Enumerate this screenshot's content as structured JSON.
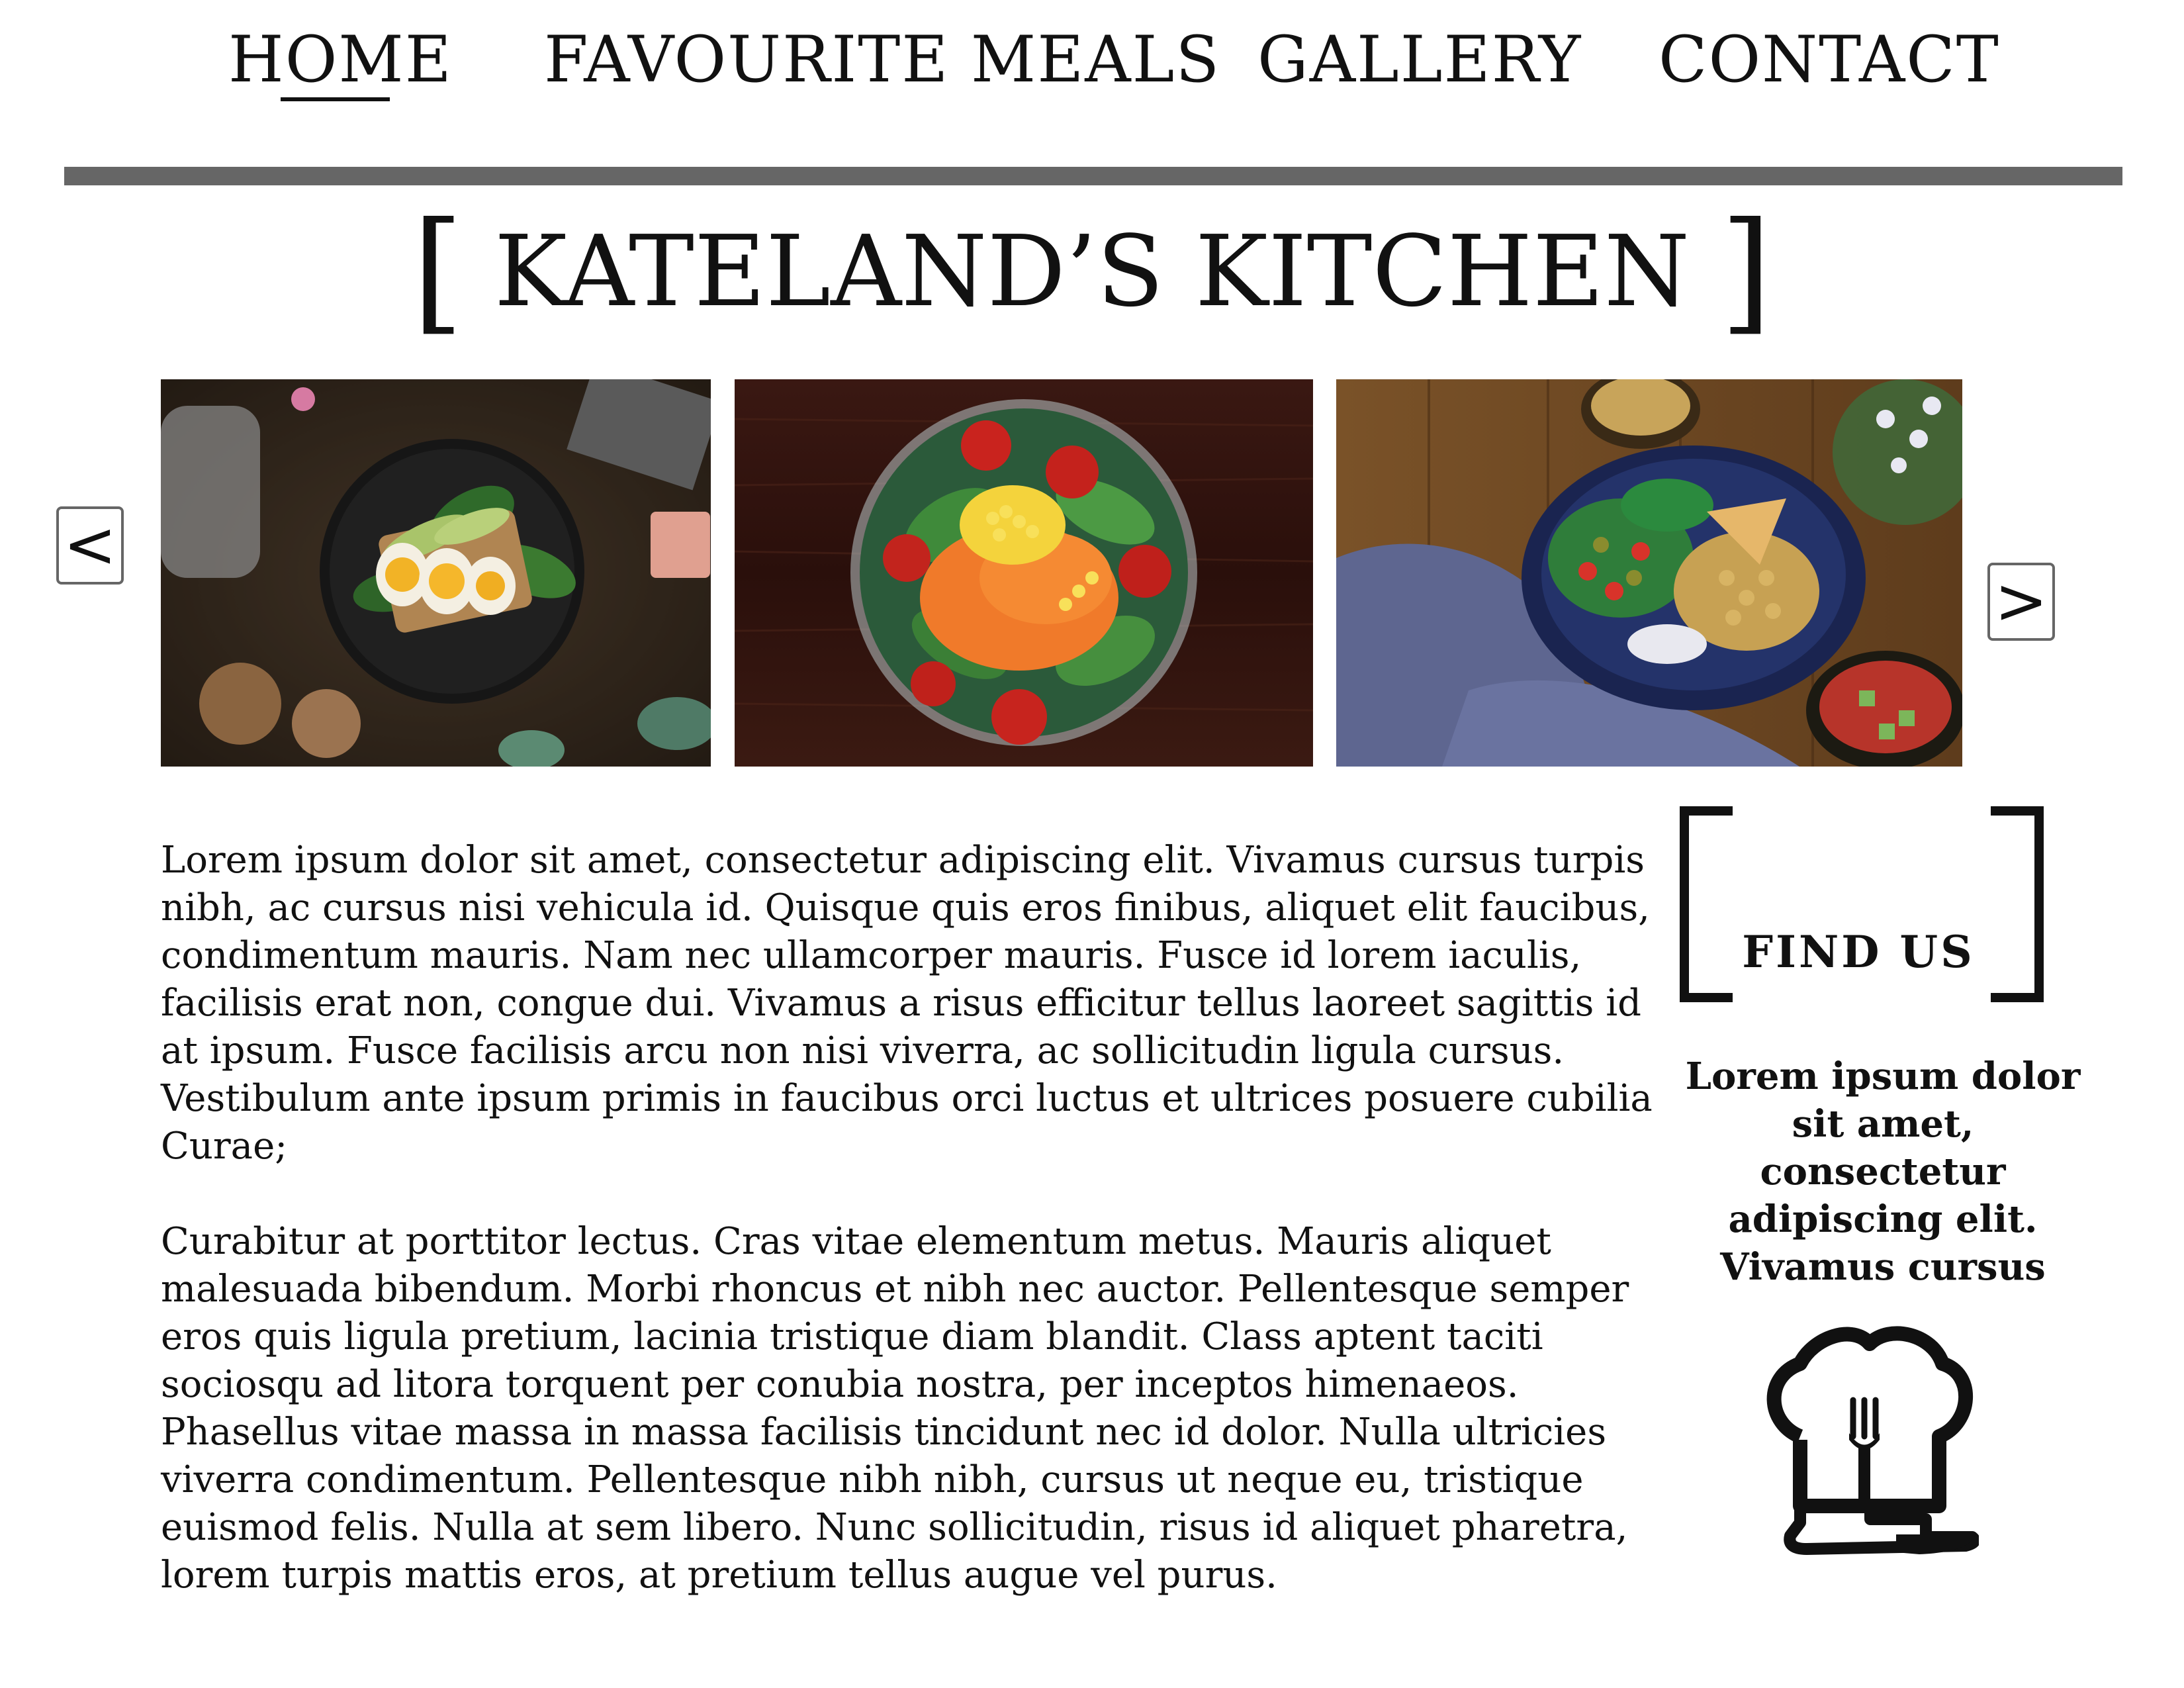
{
  "nav": {
    "items": [
      {
        "label": "HOME"
      },
      {
        "label": "FAVOURITE MEALS"
      },
      {
        "label": "GALLERY"
      },
      {
        "label": "CONTACT"
      }
    ],
    "active": "HOME"
  },
  "header": {
    "bracket_open": "[",
    "title": "KATELAND’S KITCHEN",
    "bracket_close": "]"
  },
  "carousel": {
    "prev_label": "<",
    "next_label": ">",
    "images": [
      {
        "name": "avocado-egg-toast-photo"
      },
      {
        "name": "salad-bowl-photo"
      },
      {
        "name": "chickpea-bowl-photo"
      }
    ]
  },
  "article": {
    "paragraphs": [
      "Lorem ipsum dolor sit amet, consectetur adipiscing elit. Vivamus cursus turpis nibh, ac cursus nisi vehicula id. Quisque quis eros finibus, aliquet elit faucibus, condimentum mauris. Nam nec ullamcorper mauris. Fusce id lorem iaculis, facilisis erat non, congue dui. Vivamus a risus efficitur tellus laoreet sagittis id at ipsum. Fusce facilisis arcu non nisi viverra, ac sollicitudin ligula cursus. Vestibulum ante ipsum primis in faucibus orci luctus et ultrices posuere cubilia Curae;",
      "Curabitur at porttitor lectus. Cras vitae elementum metus. Mauris aliquet malesuada bibendum. Morbi rhoncus et nibh nec auctor. Pellentesque semper eros quis ligula pretium, lacinia tristique diam blandit. Class aptent taciti sociosqu ad litora torquent per conubia nostra, per inceptos himenaeos. Phasellus vitae massa in massa facilisis tincidunt nec id dolor. Nulla ultricies viverra condimentum. Pellentesque nibh nibh, cursus ut neque eu, tristique euismod felis. Nulla at sem libero. Nunc sollicitudin, risus id aliquet pharetra, lorem turpis mattis eros, at pretium tellus augue vel purus."
    ]
  },
  "find_us": {
    "title": "FIND US",
    "text": "Lorem ipsum dolor sit amet, consectetur adipiscing elit. Vivamus cursus",
    "icon": "chef-hat-fork-knife-icon"
  },
  "colors": {
    "divider": "#666666",
    "text": "#111111",
    "background": "#ffffff"
  }
}
